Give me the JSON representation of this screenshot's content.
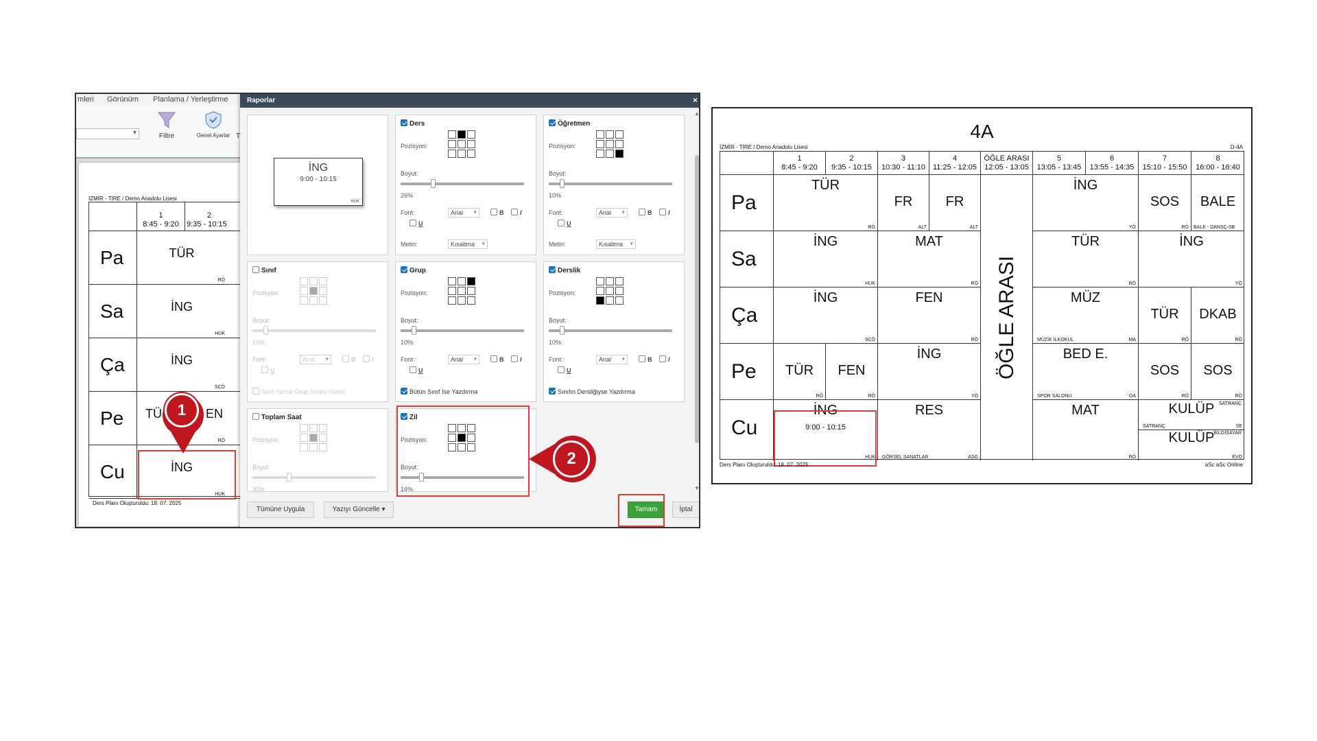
{
  "left": {
    "menu": [
      "mleri",
      "Görünüm",
      "Planlama / Yerleştirme"
    ],
    "toolbar": {
      "filter": "Filtre",
      "settings": "Genel Ayarlar",
      "more": "T"
    },
    "preview": {
      "school": "İZMİR - TİRE / Demo Anadolu Lisesi",
      "periods": [
        {
          "num": "1",
          "time": "8:45 - 9:20"
        },
        {
          "num": "2",
          "time": "9:35 - 10:15"
        }
      ],
      "rows": [
        {
          "day": "Pa",
          "subject": "TÜR",
          "teacher": "RÖ"
        },
        {
          "day": "Sa",
          "subject": "İNG",
          "teacher": "HUK"
        },
        {
          "day": "Ça",
          "subject": "İNG",
          "teacher": "SCÖ"
        },
        {
          "day": "Pe",
          "subject": "TÜ",
          "subject2": "EN",
          "teacher": "RÖ"
        },
        {
          "day": "Cu",
          "subject": "İNG",
          "teacher": "HUK"
        }
      ],
      "footer": "Ders Planı Oluşturuldu: 18. 07. 2025"
    },
    "badge1": "1",
    "badge2": "2"
  },
  "dialog": {
    "title": "Raporlar",
    "close": "×",
    "sample": {
      "subject": "İNG",
      "time": "9:00 - 10:15",
      "teacher": "HUK"
    },
    "labels": {
      "position": "Pozisyon:",
      "size": "Boyut:",
      "font": "Font:",
      "text": "Metin:",
      "bold": "B",
      "italic": "I",
      "underline": "U",
      "font_value": "Arial",
      "text_value": "Kısaltma"
    },
    "panels": {
      "ders": {
        "title": "Ders",
        "size": "26%"
      },
      "ogretmen": {
        "title": "Öğretmen",
        "size": "10%"
      },
      "sinif": {
        "title": "Sınıf",
        "size": "10%",
        "extra": "Sınıf Yerine Grup İsmini Yazdır"
      },
      "grup": {
        "title": "Grup",
        "size": "10%",
        "extra": "Bütün Sınıf İse Yazdırma"
      },
      "derslik": {
        "title": "Derslik",
        "size": "10%",
        "extra": "Sınıfın Dersliğiyse Yazdırma"
      },
      "toplam": {
        "title": "Toplam Saat",
        "size": "30%"
      },
      "zil": {
        "title": "Zil",
        "size": "16%"
      }
    },
    "buttons": {
      "apply_all": "Tümüne Uygula",
      "update_text": "Yazıyı Güncelle ▾",
      "ok": "Tamam",
      "cancel": "İptal"
    }
  },
  "timetable": {
    "title": "4A",
    "school": "İZMİR - TİRE / Demo Anadolu Lisesi",
    "code": "D-4A",
    "periods": [
      {
        "num": "1",
        "time": "8:45 - 9:20"
      },
      {
        "num": "2",
        "time": "9:35 - 10:15"
      },
      {
        "num": "3",
        "time": "10:30 - 11:10"
      },
      {
        "num": "4",
        "time": "11:25 - 12:05"
      },
      {
        "num": "ÖĞLE ARASI",
        "time": "12:05 - 13:05"
      },
      {
        "num": "5",
        "time": "13:05 - 13:45"
      },
      {
        "num": "6",
        "time": "13:55 - 14:35"
      },
      {
        "num": "7",
        "time": "15:10 - 15:50"
      },
      {
        "num": "8",
        "time": "16:00 - 16:40"
      }
    ],
    "days": [
      "Pa",
      "Sa",
      "Ça",
      "Pe",
      "Cu"
    ],
    "lunch": "ÖĞLE ARASI",
    "lessons": {
      "pa_tur": {
        "s": "TÜR",
        "t": "RÖ"
      },
      "pa_fr1": {
        "s": "FR",
        "t": "ALT"
      },
      "pa_fr2": {
        "s": "FR",
        "t": "ALT"
      },
      "pa_ing": {
        "s": "İNG",
        "t": "YÖ"
      },
      "pa_sos": {
        "s": "SOS",
        "t": "RÖ"
      },
      "pa_bale": {
        "s": "BALE",
        "t": "BALE - DANSÇ-SB"
      },
      "sa_ing": {
        "s": "İNG",
        "t": "HUK"
      },
      "sa_mat": {
        "s": "MAT",
        "t": "RÖ"
      },
      "sa_tur": {
        "s": "TÜR",
        "t": "RÖ"
      },
      "sa_ing2": {
        "s": "İNG",
        "t": "YÖ"
      },
      "ca_ing": {
        "s": "İNG",
        "t": "SCÖ"
      },
      "ca_fen": {
        "s": "FEN",
        "t": "RÖ"
      },
      "ca_muz": {
        "s": "MÜZ",
        "t": "MA",
        "r": "MÜZİK İLKOKUL"
      },
      "ca_tur": {
        "s": "TÜR",
        "t": "RÖ"
      },
      "ca_dkab": {
        "s": "DKAB",
        "t": "RÖ"
      },
      "pe_tur": {
        "s": "TÜR",
        "t": "RÖ"
      },
      "pe_fen": {
        "s": "FEN",
        "t": "RÖ"
      },
      "pe_ing": {
        "s": "İNG",
        "t": "YÖ"
      },
      "pe_bed": {
        "s": "BED E.",
        "t": "OA",
        "r": "SPOR SALONU"
      },
      "pe_sos1": {
        "s": "SOS",
        "t": "RÖ"
      },
      "pe_sos2": {
        "s": "SOS",
        "t": "RÖ"
      },
      "cu_ing": {
        "s": "İNG",
        "t": "HUK",
        "time": "9:00 - 10:15"
      },
      "cu_res": {
        "s": "RES",
        "t": "ASG",
        "r": "GÖRSEL SANATLAR"
      },
      "cu_mat": {
        "s": "MAT",
        "t": "RÖ"
      },
      "cu_kulup1": {
        "s": "KULÜP",
        "g": "SATRANÇ",
        "r": "SATRANÇ",
        "t": "SE"
      },
      "cu_kulup2": {
        "s": "KULÜP",
        "g": "BİLGİSAYAR",
        "t": "EVÖ"
      }
    },
    "footer_left": "Ders Planı Oluşturuldu: 18. 07. 2025",
    "footer_right": "aSc aSc Online"
  },
  "colors": {
    "highlight": "#e53935",
    "badge": "#c0171f",
    "ok": "#3aa33a",
    "titlebar": "#3b4a56",
    "checkbox": "#1a73c8"
  }
}
